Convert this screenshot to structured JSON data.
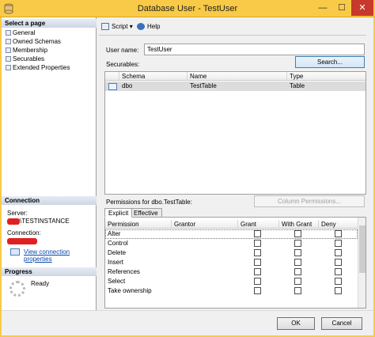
{
  "window": {
    "title": "Database User - TestUser",
    "minimize": "—",
    "maximize": "☐",
    "close": "✕"
  },
  "left": {
    "select_page_header": "Select a page",
    "pages": [
      "General",
      "Owned Schemas",
      "Membership",
      "Securables",
      "Extended Properties"
    ],
    "connection_header": "Connection",
    "server_label": "Server:",
    "server_value": "\\TESTINSTANCE",
    "connection_label": "Connection:",
    "view_connection_properties": "View connection properties",
    "progress_header": "Progress",
    "progress_status": "Ready"
  },
  "toolbar": {
    "script_label": "Script",
    "script_dropdown": "▾",
    "help_label": "Help"
  },
  "form": {
    "user_name_label": "User name:",
    "user_name_value": "TestUser",
    "securables_label": "Securables:",
    "search_button": "Search..."
  },
  "securables_table": {
    "columns": [
      "Schema",
      "Name",
      "Type"
    ],
    "rows": [
      {
        "schema": "dbo",
        "name": "TestTable",
        "type": "Table"
      }
    ]
  },
  "permissions": {
    "label": "Permissions for dbo.TestTable:",
    "column_permissions_button": "Column Permissions...",
    "tabs": [
      "Explicit",
      "Effective"
    ],
    "columns": [
      "Permission",
      "Grantor",
      "Grant",
      "With Grant",
      "Deny"
    ],
    "rows": [
      {
        "permission": "Alter",
        "grantor": "",
        "grant": false,
        "with_grant": false,
        "deny": false
      },
      {
        "permission": "Control",
        "grantor": "",
        "grant": false,
        "with_grant": false,
        "deny": false
      },
      {
        "permission": "Delete",
        "grantor": "",
        "grant": false,
        "with_grant": false,
        "deny": false
      },
      {
        "permission": "Insert",
        "grantor": "",
        "grant": false,
        "with_grant": false,
        "deny": false
      },
      {
        "permission": "References",
        "grantor": "",
        "grant": false,
        "with_grant": false,
        "deny": false
      },
      {
        "permission": "Select",
        "grantor": "",
        "grant": false,
        "with_grant": false,
        "deny": false
      },
      {
        "permission": "Take ownership",
        "grantor": "",
        "grant": false,
        "with_grant": false,
        "deny": false
      }
    ]
  },
  "footer": {
    "ok_button": "OK",
    "cancel_button": "Cancel"
  }
}
